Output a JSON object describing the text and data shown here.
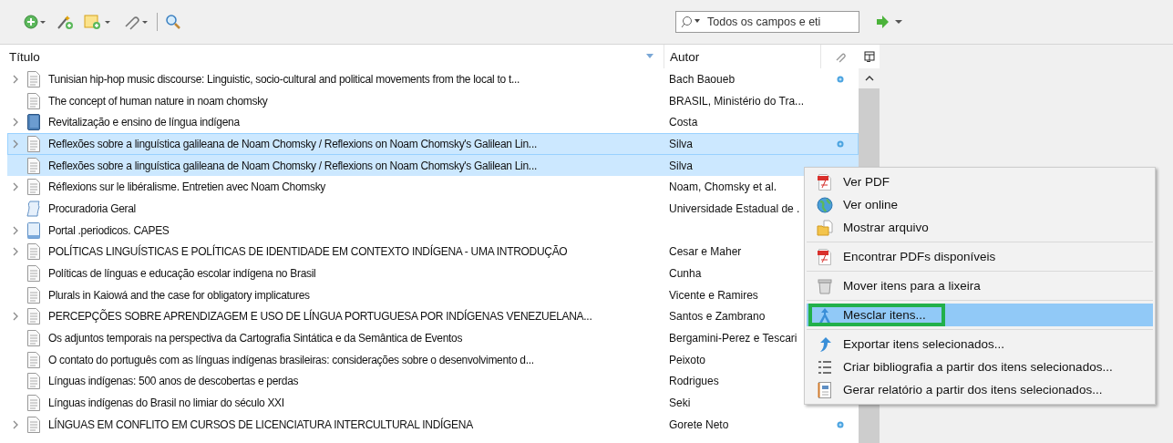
{
  "toolbar": {
    "search": {
      "placeholder": "Todos os campos e eti"
    }
  },
  "table": {
    "columns": [
      {
        "label": "Título",
        "sorted": true
      },
      {
        "label": "Autor",
        "sorted": false
      }
    ],
    "rows": [
      {
        "title": "Tunisian hip-hop music discourse: Linguistic, socio-cultural and political movements from the local to t...",
        "author": "Bach Baoueb",
        "kind": "document",
        "expandable": true,
        "selected": false,
        "focused": false,
        "has_attachment": true
      },
      {
        "title": "The concept of human nature in noam chomsky",
        "author": "BRASIL, Ministério do Tra...",
        "kind": "document",
        "expandable": false,
        "selected": false,
        "focused": false,
        "has_attachment": false
      },
      {
        "title": "Revitalização e ensino de língua indígena",
        "author": "Costa",
        "kind": "book",
        "expandable": true,
        "selected": false,
        "focused": false,
        "has_attachment": false
      },
      {
        "title": "Reflexões sobre a linguística galileana de Noam Chomsky / Reflexions on Noam Chomsky's Galilean Lin...",
        "author": "Silva",
        "kind": "document",
        "expandable": true,
        "selected": true,
        "focused": true,
        "has_attachment": true
      },
      {
        "title": "Reflexões sobre a linguística galileana de Noam Chomsky / Reflexions on Noam Chomsky's Galilean Lin...",
        "author": "Silva",
        "kind": "document",
        "expandable": false,
        "selected": true,
        "focused": false,
        "has_attachment": false
      },
      {
        "title": "Réflexions sur le libéralisme. Entretien avec Noam Chomsky",
        "author": "Noam, Chomsky et al.",
        "kind": "document",
        "expandable": true,
        "selected": false,
        "focused": false
      },
      {
        "title": "Procuradoria Geral",
        "author": "Universidade Estadual de .",
        "kind": "manuscript",
        "expandable": false,
        "selected": false,
        "focused": false
      },
      {
        "title": "Portal .periodicos. CAPES",
        "author": "",
        "kind": "webpage",
        "expandable": true,
        "selected": false,
        "focused": false
      },
      {
        "title": "POLÍTICAS LINGUÍSTICAS E POLÍTICAS DE IDENTIDADE EM CONTEXTO INDÍGENA - UMA INTRODUÇÃO",
        "author": "Cesar e Maher",
        "kind": "document",
        "expandable": true,
        "selected": false,
        "focused": false
      },
      {
        "title": "Políticas de línguas e educação escolar indígena no Brasil",
        "author": "Cunha",
        "kind": "document",
        "expandable": false,
        "selected": false,
        "focused": false
      },
      {
        "title": "Plurals in Kaiowá and the case for obligatory implicatures",
        "author": "Vicente e Ramires",
        "kind": "document",
        "expandable": false,
        "selected": false,
        "focused": false
      },
      {
        "title": "PERCEPÇÕES SOBRE APRENDIZAGEM E USO DE LÍNGUA PORTUGUESA POR INDÍGENAS VENEZUELANA...",
        "author": "Santos e Zambrano",
        "kind": "document",
        "expandable": true,
        "selected": false,
        "focused": false
      },
      {
        "title": "Os adjuntos temporais na perspectiva da Cartografia Sintática e da Semântica de Eventos",
        "author": "Bergamini-Perez e Tescari",
        "kind": "document",
        "expandable": false,
        "selected": false,
        "focused": false
      },
      {
        "title": "O contato do português com as línguas indígenas brasileiras: considerações sobre o desenvolvimento d...",
        "author": "Peixoto",
        "kind": "document",
        "expandable": false,
        "selected": false,
        "focused": false
      },
      {
        "title": "Línguas indígenas: 500 anos de descobertas e perdas",
        "author": "Rodrigues",
        "kind": "document",
        "expandable": false,
        "selected": false,
        "focused": false
      },
      {
        "title": "Línguas indígenas do Brasil no limiar do século XXI",
        "author": "Seki",
        "kind": "document",
        "expandable": false,
        "selected": false,
        "focused": false,
        "has_attachment": false
      },
      {
        "title": "LÍNGUAS EM CONFLITO EM CURSOS DE LICENCIATURA INTERCULTURAL INDÍGENA",
        "author": "Gorete Neto",
        "kind": "document",
        "expandable": true,
        "selected": false,
        "focused": false,
        "has_attachment": true
      }
    ]
  },
  "context_menu": {
    "sections": [
      [
        {
          "label": "Ver PDF",
          "kind": "pdf",
          "selected": false,
          "annotated": false
        },
        {
          "label": "Ver online",
          "kind": "web",
          "selected": false,
          "annotated": false
        },
        {
          "label": "Mostrar arquivo",
          "kind": "file",
          "selected": false,
          "annotated": false
        }
      ],
      [
        {
          "label": "Encontrar PDFs disponíveis",
          "kind": "pdf",
          "selected": false,
          "annotated": false
        }
      ],
      [
        {
          "label": "Mover itens para a lixeira",
          "kind": "trash",
          "selected": false,
          "annotated": false
        }
      ],
      [
        {
          "label": "Mesclar itens...",
          "kind": "merge",
          "selected": true,
          "annotated": true
        }
      ],
      [
        {
          "label": "Exportar itens selecionados...",
          "kind": "export",
          "selected": false,
          "annotated": false
        },
        {
          "label": "Criar bibliografia a partir dos itens selecionados...",
          "kind": "bibliography",
          "selected": false,
          "annotated": false
        },
        {
          "label": "Gerar relatório a partir dos itens selecionados...",
          "kind": "report",
          "selected": false,
          "annotated": false
        }
      ]
    ]
  }
}
